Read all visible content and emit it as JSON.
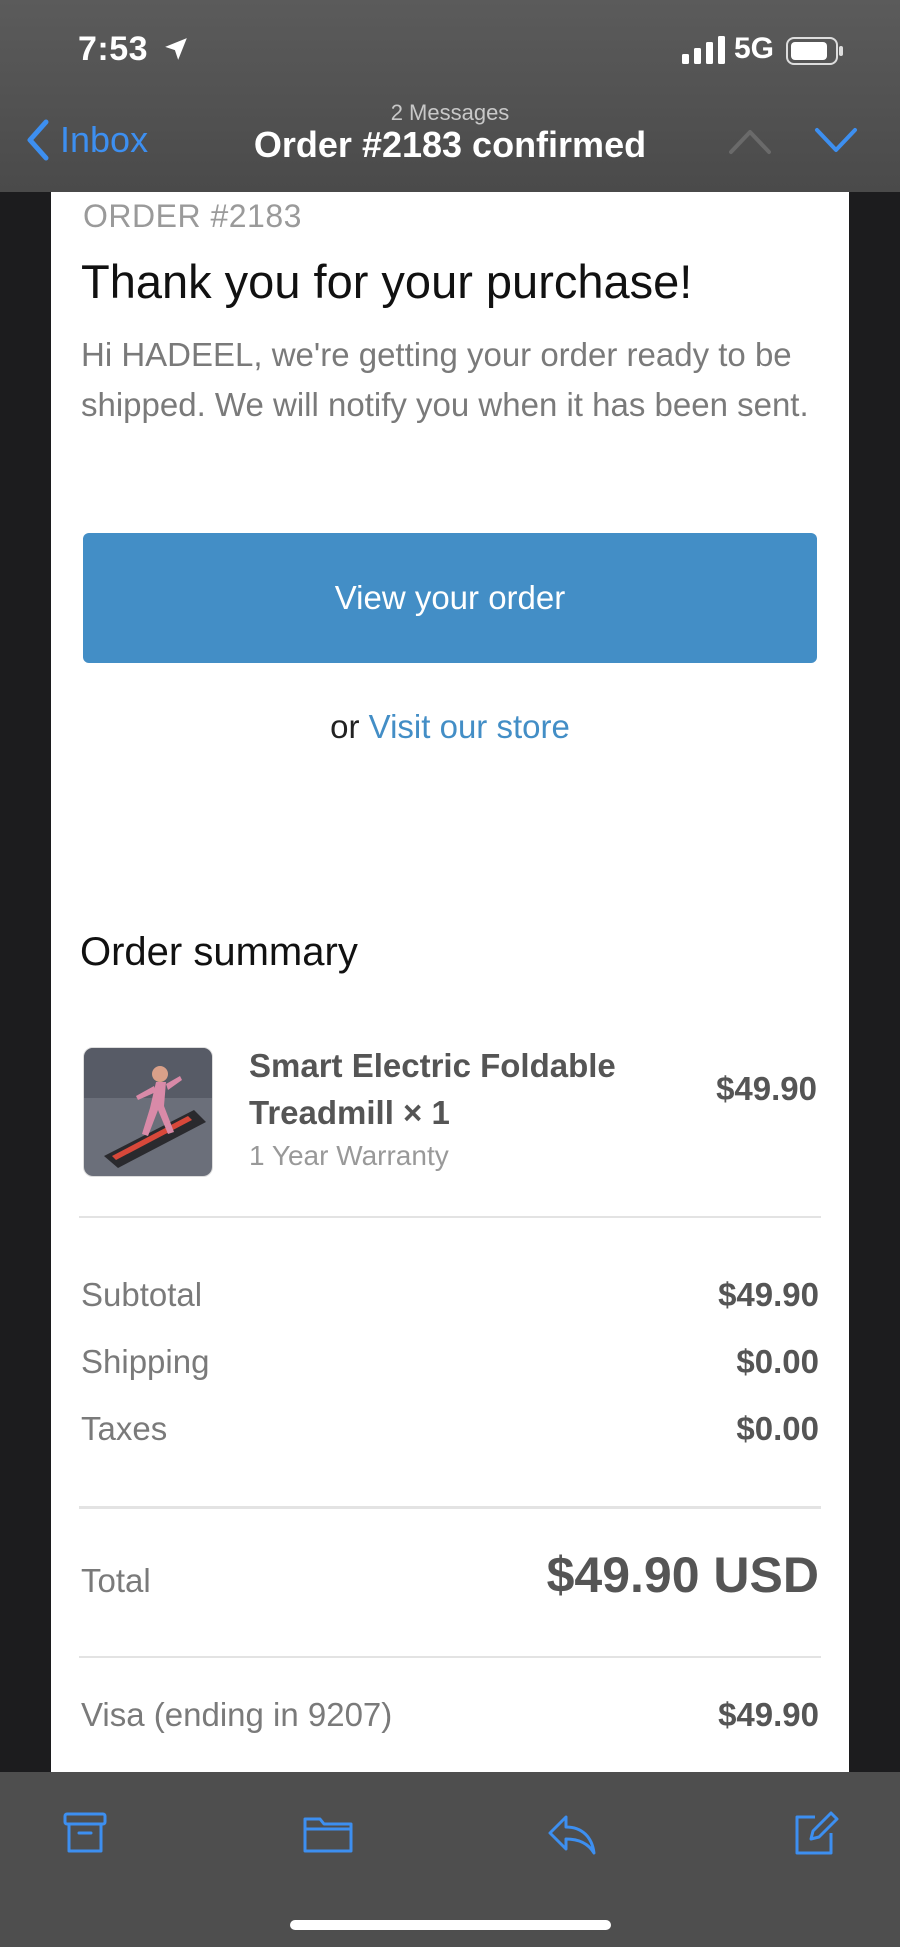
{
  "status_bar": {
    "time": "7:53",
    "network": "5G"
  },
  "nav": {
    "back_label": "Inbox",
    "message_count": "2 Messages",
    "title": "Order #2183 confirmed"
  },
  "email": {
    "order_number": "ORDER #2183",
    "headline": "Thank you for your purchase!",
    "intro": "Hi HADEEL, we're getting your order ready to be shipped. We will notify you when it has been sent.",
    "cta_label": "View your order",
    "alt_prefix": "or ",
    "alt_link": "Visit our store",
    "summary_title": "Order summary",
    "item": {
      "name": "Smart Electric Foldable Treadmill × 1",
      "variant": "1 Year Warranty",
      "price": "$49.90"
    },
    "totals": [
      {
        "label": "Subtotal",
        "value": "$49.90"
      },
      {
        "label": "Shipping",
        "value": "$0.00"
      },
      {
        "label": "Taxes",
        "value": "$0.00"
      }
    ],
    "total": {
      "label": "Total",
      "value": "$49.90 USD"
    },
    "payment": {
      "label": "Visa (ending in 9207)",
      "value": "$49.90"
    }
  },
  "colors": {
    "accent": "#3d8ff0",
    "button": "#438ec6",
    "link": "#438ec6"
  },
  "toolbar": {
    "icons": [
      "archive-icon",
      "folder-icon",
      "reply-icon",
      "compose-icon"
    ]
  }
}
